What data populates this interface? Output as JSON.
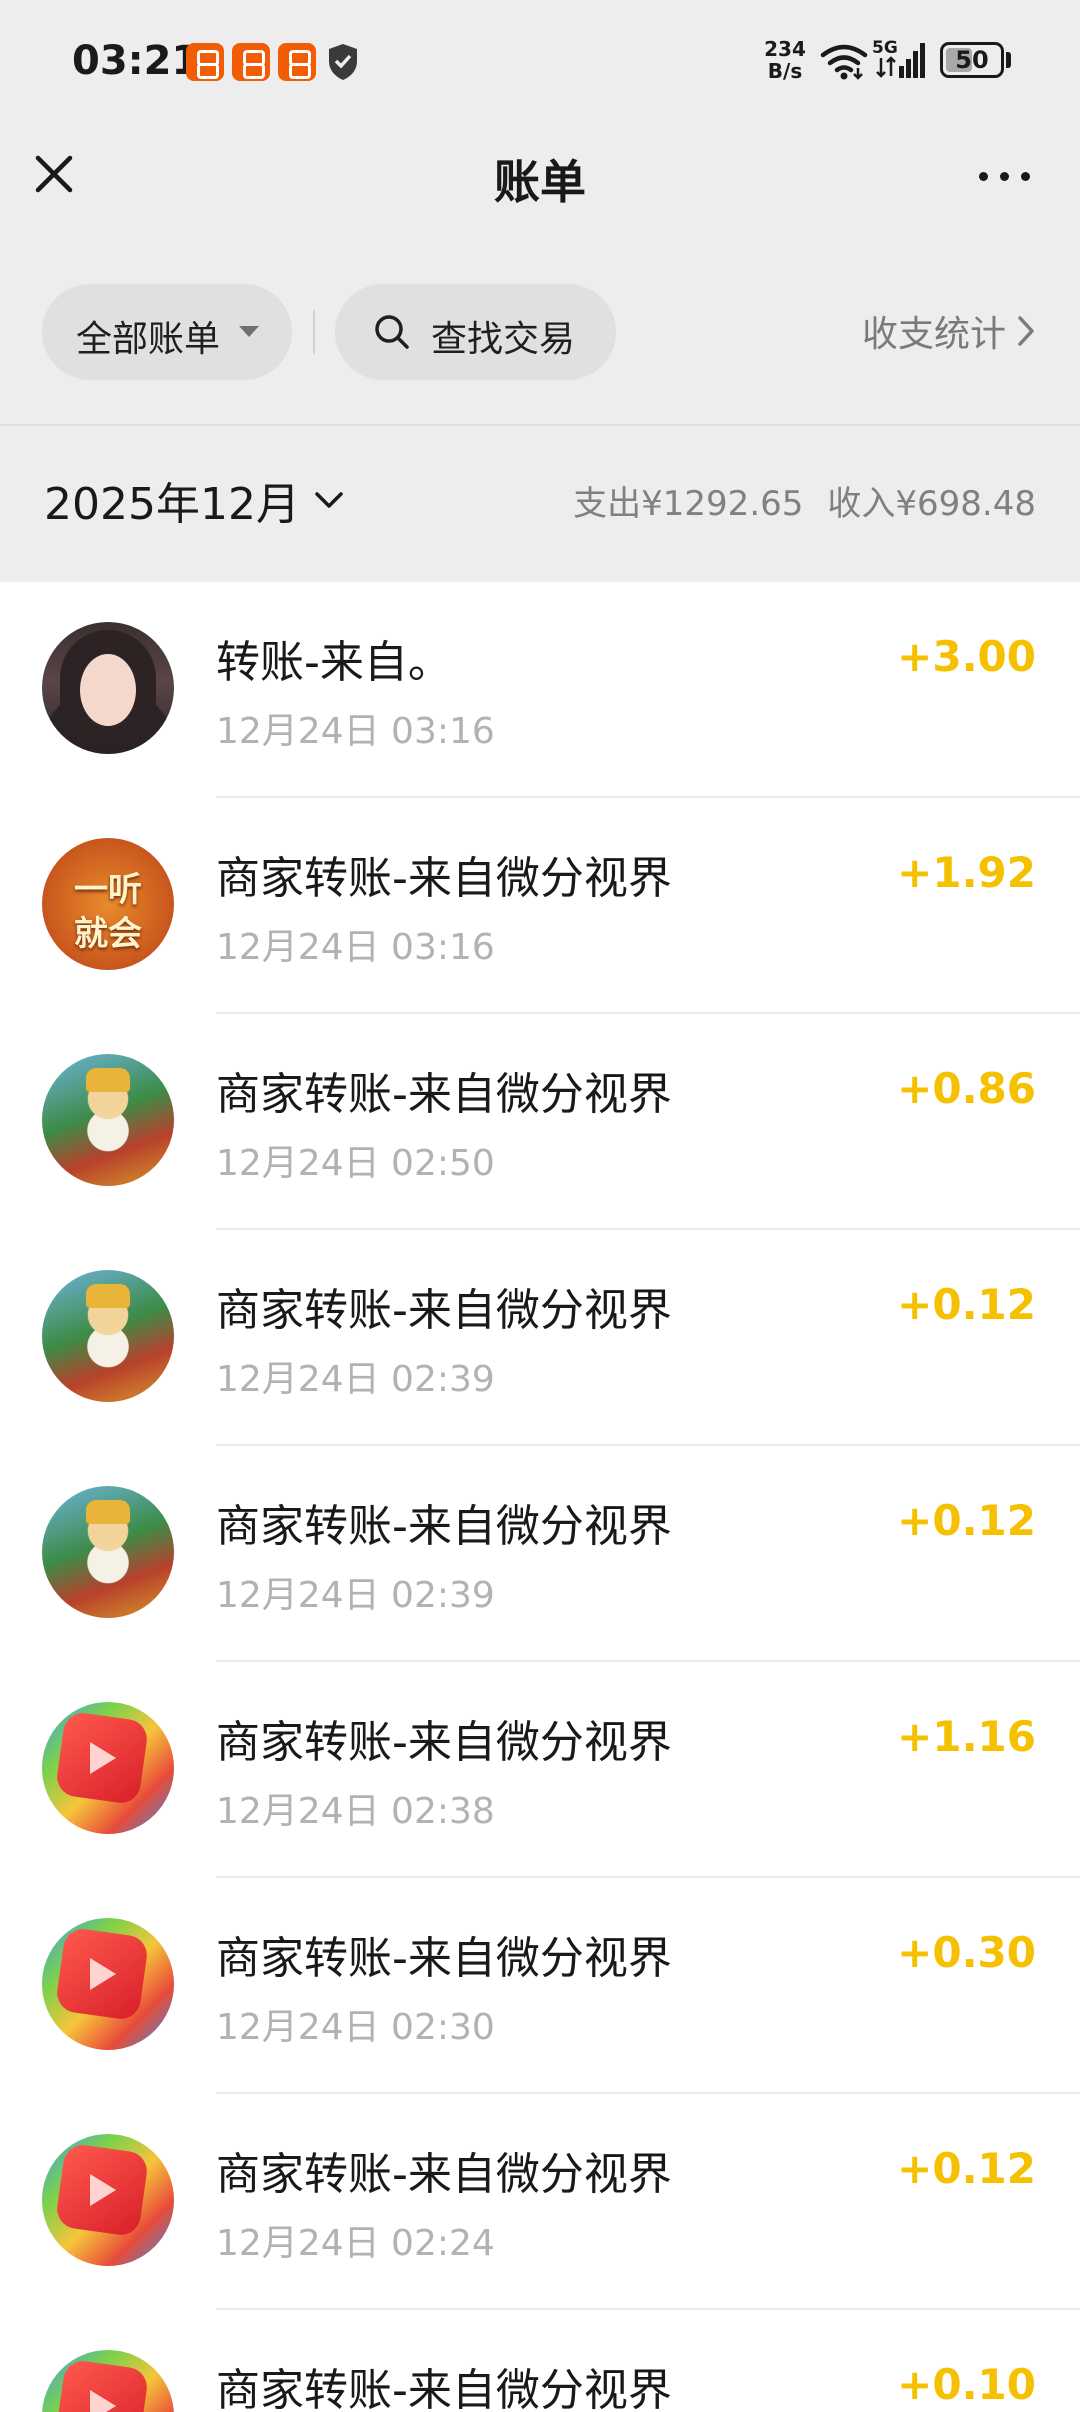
{
  "status_bar": {
    "time": "03:21",
    "net_speed_value": "234",
    "net_speed_unit": "B/s",
    "network": "5G",
    "battery": "50",
    "battery_level": 0.5
  },
  "nav": {
    "title": "账单",
    "close_icon": "close-icon",
    "more_icon": "more-icon"
  },
  "filters": {
    "all_bills": "全部账单",
    "search": "查找交易",
    "stats": "收支统计"
  },
  "summary": {
    "month": "2025年12月",
    "expense": "支出¥1292.65",
    "income": "收入¥698.48"
  },
  "colors": {
    "background_top": "#ededed",
    "amount": "#f5c000",
    "secondary_text": "#b2b2b2"
  },
  "transactions": [
    {
      "title": "转账-来自。",
      "time": "12月24日 03:16",
      "amount": "+3.00",
      "avatar": "avatar-girl"
    },
    {
      "title": "商家转账-来自微分视界",
      "time": "12月24日 03:16",
      "amount": "+1.92",
      "avatar": "avatar-text",
      "avatar_text_1": "一听",
      "avatar_text_2": "就会"
    },
    {
      "title": "商家转账-来自微分视界",
      "time": "12月24日 02:50",
      "amount": "+0.86",
      "avatar": "avatar-god"
    },
    {
      "title": "商家转账-来自微分视界",
      "time": "12月24日 02:39",
      "amount": "+0.12",
      "avatar": "avatar-god"
    },
    {
      "title": "商家转账-来自微分视界",
      "time": "12月24日 02:39",
      "amount": "+0.12",
      "avatar": "avatar-god"
    },
    {
      "title": "商家转账-来自微分视界",
      "time": "12月24日 02:38",
      "amount": "+1.16",
      "avatar": "avatar-game"
    },
    {
      "title": "商家转账-来自微分视界",
      "time": "12月24日 02:30",
      "amount": "+0.30",
      "avatar": "avatar-game"
    },
    {
      "title": "商家转账-来自微分视界",
      "time": "12月24日 02:24",
      "amount": "+0.12",
      "avatar": "avatar-game"
    },
    {
      "title": "商家转账-来自微分视界",
      "time": "",
      "amount": "+0.10",
      "avatar": "avatar-game"
    }
  ]
}
